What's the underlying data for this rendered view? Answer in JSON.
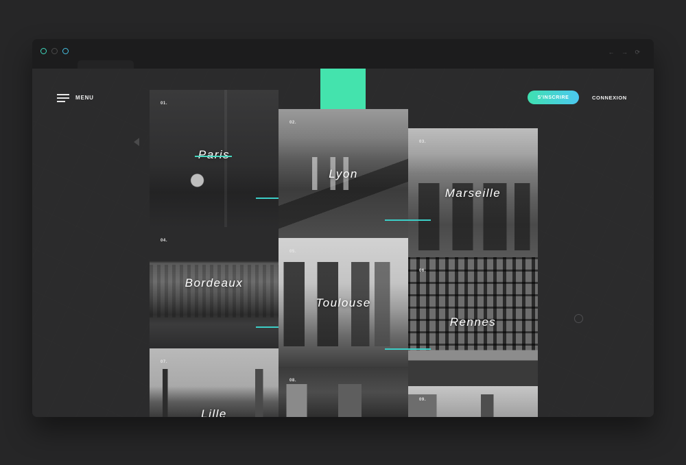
{
  "window": {
    "controls": [
      "close-dot",
      "minimize-dot",
      "maximize-dot"
    ],
    "nav_arrows": "← → ⟳"
  },
  "header": {
    "menu_label": "MENU",
    "signup_label": "S'INSCRIRE",
    "login_label": "CONNEXION"
  },
  "colors": {
    "accent_green": "#44e3ad",
    "accent_blue": "#4cc8f0",
    "underline": "#3ccfc8"
  },
  "cities": [
    {
      "num": "01.",
      "name": "Paris"
    },
    {
      "num": "02.",
      "name": "Lyon"
    },
    {
      "num": "03.",
      "name": "Marseille"
    },
    {
      "num": "04.",
      "name": "Bordeaux"
    },
    {
      "num": "05.",
      "name": "Toulouse"
    },
    {
      "num": "06.",
      "name": "Rennes"
    },
    {
      "num": "07.",
      "name": "Lille"
    },
    {
      "num": "08.",
      "name": ""
    },
    {
      "num": "09.",
      "name": ""
    }
  ]
}
